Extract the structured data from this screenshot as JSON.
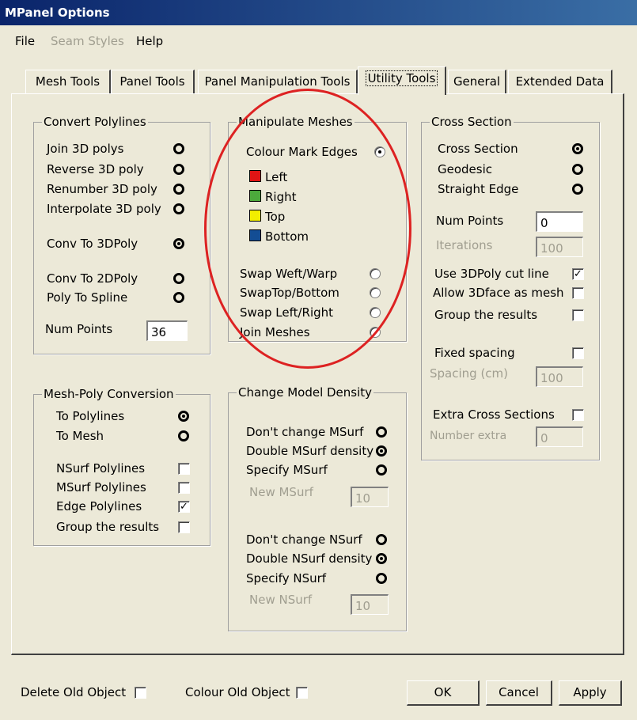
{
  "window": {
    "title": "MPanel Options"
  },
  "menu": {
    "file": "File",
    "seam_styles": "Seam Styles",
    "help": "Help"
  },
  "tabs": [
    {
      "label": "Mesh Tools"
    },
    {
      "label": "Panel Tools"
    },
    {
      "label": "Panel Manipulation Tools"
    },
    {
      "label": "Utility Tools",
      "active": true
    },
    {
      "label": "General"
    },
    {
      "label": "Extended Data"
    }
  ],
  "convert_polylines": {
    "title": "Convert Polylines",
    "options": [
      {
        "label": "Join 3D polys",
        "checked": false
      },
      {
        "label": "Reverse 3D poly",
        "checked": false
      },
      {
        "label": "Renumber 3D poly",
        "checked": false
      },
      {
        "label": "Interpolate 3D poly",
        "checked": false
      },
      {
        "label": "Conv To 3DPoly",
        "checked": true
      },
      {
        "label": "Conv To 2DPoly",
        "checked": false
      },
      {
        "label": "Poly To Spline",
        "checked": false
      }
    ],
    "num_points_label": "Num Points",
    "num_points_value": "36"
  },
  "manipulate_meshes": {
    "title": "Manipulate Meshes",
    "colour_mark_edges": "Colour Mark Edges",
    "legend": [
      {
        "label": "Left",
        "color": "#e01414"
      },
      {
        "label": "Right",
        "color": "#4caa3c"
      },
      {
        "label": "Top",
        "color": "#f2ee00"
      },
      {
        "label": "Bottom",
        "color": "#134d94"
      }
    ],
    "swap_weft_warp": "Swap Weft/Warp",
    "swap_top_bottom": "SwapTop/Bottom",
    "swap_left_right": "Swap Left/Right",
    "join_meshes": "Join Meshes"
  },
  "cross_section": {
    "title": "Cross Section",
    "options": [
      {
        "label": "Cross Section",
        "checked": true
      },
      {
        "label": "Geodesic",
        "checked": false
      },
      {
        "label": "Straight Edge",
        "checked": false
      }
    ],
    "num_points_label": "Num Points",
    "num_points_value": "0",
    "iterations_label": "Iterations",
    "iterations_value": "100",
    "use_3dpoly_cut_line": "Use 3DPoly cut line",
    "allow_3dface_as_mesh": "Allow 3Dface as mesh",
    "group_results": "Group the results",
    "fixed_spacing": "Fixed spacing",
    "spacing_label": "Spacing (cm)",
    "spacing_value": "100",
    "extra_cross_sections": "Extra Cross Sections",
    "number_extra_label": "Number extra",
    "number_extra_value": "0"
  },
  "mesh_poly": {
    "title": "Mesh-Poly Conversion",
    "to_polylines": "To Polylines",
    "to_mesh": "To Mesh",
    "nsurf_polylines": "NSurf Polylines",
    "msurf_polylines": "MSurf Polylines",
    "edge_polylines": "Edge Polylines",
    "group_results": "Group the results"
  },
  "density": {
    "title": "Change Model Density",
    "dont_change_msurf": "Don't change MSurf",
    "double_msurf": "Double MSurf density",
    "specify_msurf": "Specify MSurf",
    "new_msurf_label": "New MSurf",
    "new_msurf_value": "10",
    "dont_change_nsurf": "Don't change NSurf",
    "double_nsurf": "Double NSurf density",
    "specify_nsurf": "Specify NSurf",
    "new_nsurf_label": "New NSurf",
    "new_nsurf_value": "10"
  },
  "footer": {
    "delete_old_object": "Delete Old Object",
    "colour_old_object": "Colour Old Object",
    "ok": "OK",
    "cancel": "Cancel",
    "apply": "Apply"
  },
  "check_mark": "✓"
}
